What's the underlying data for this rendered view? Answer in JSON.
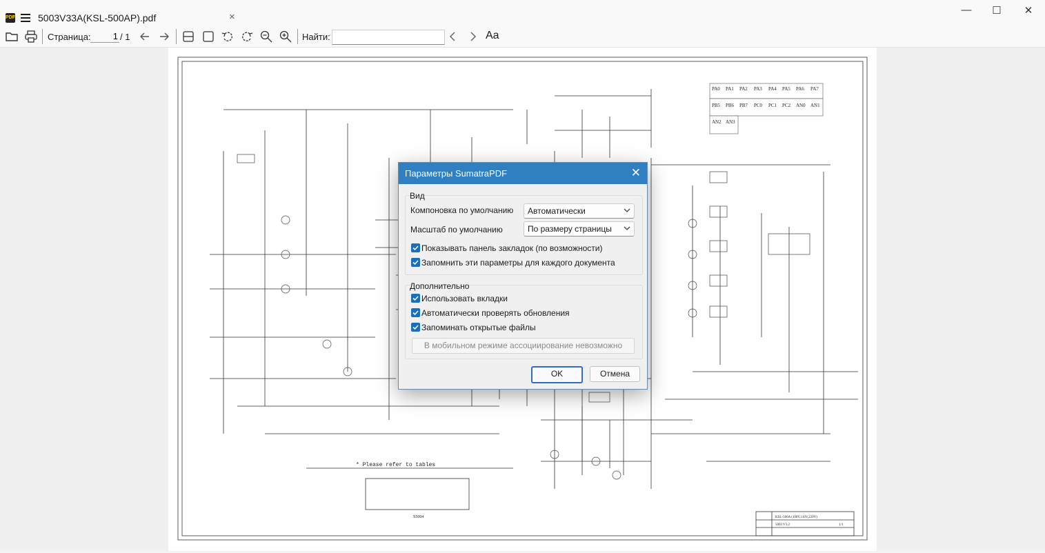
{
  "window": {
    "tab_title": "5003V33A(KSL-500AP).pdf",
    "tab_close": "×",
    "minimize": "—",
    "maximize": "☐",
    "close": "✕",
    "app_icon_text": "PDF"
  },
  "toolbar": {
    "page_label": "Страница:",
    "page_current": "1",
    "page_total": "/ 1",
    "find_label": "Найти:",
    "find_value": "",
    "font_toggle": "Aa"
  },
  "dialog": {
    "title": "Параметры SumatraPDF",
    "close": "✕",
    "view_group": {
      "label": "Вид",
      "layout_label": "Компоновка по умолчанию",
      "layout_value": "Автоматически",
      "zoom_label": "Масштаб по умолчанию",
      "zoom_value": "По размеру страницы",
      "checkboxes": [
        {
          "label": "Показывать панель закладок (по возможности)",
          "checked": true
        },
        {
          "label": "Запомнить эти параметры для каждого документа",
          "checked": true
        }
      ]
    },
    "advanced_group": {
      "label": "Дополнительно",
      "checkboxes": [
        {
          "label": "Использовать вкладки",
          "checked": true
        },
        {
          "label": "Автоматически проверять обновления",
          "checked": true
        },
        {
          "label": "Запоминать открытые файлы",
          "checked": true
        }
      ],
      "disabled_button": "В мобильном режиме ассоциирование невозможно"
    },
    "ok": "OK",
    "cancel": "Отмена"
  },
  "document": {
    "refer_note": "* Please refer to tables",
    "ports_table": [
      [
        "PA0",
        "PA1",
        "PA2",
        "PA3",
        "PA4",
        "PA5",
        "PA6",
        "PA7"
      ],
      [
        "PB5",
        "PB6",
        "PB7",
        "PC0",
        "PC1",
        "PC2",
        "AN0",
        "AN1"
      ],
      [
        "AN2",
        "AN3"
      ]
    ],
    "block_label": "S5004",
    "title_block": {
      "model": "KSL-500A (100V,110V,220V)",
      "drawing_no": "5003 V3.2",
      "sheet": "1/1"
    }
  },
  "colors": {
    "title_bar": "#2f7fc1",
    "checkbox": "#1a6fb8",
    "primary_border": "#2d6fbd",
    "viewer_bg": "#f0f0f0"
  }
}
